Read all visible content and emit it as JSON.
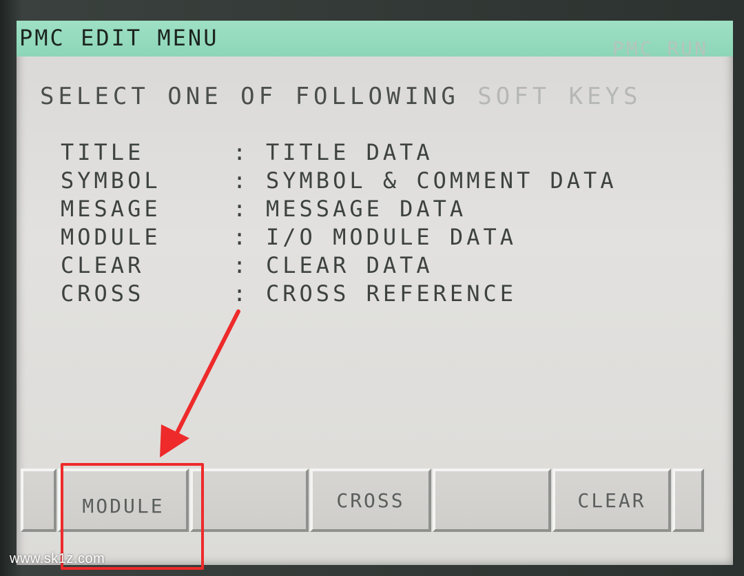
{
  "header": {
    "title": "PMC EDIT MENU",
    "status": "PMC RUN"
  },
  "prompt": {
    "main": "SELECT ONE OF FOLLOWING ",
    "faded": "SOFT KEYS"
  },
  "menu": {
    "items": [
      {
        "key": "TITLE",
        "sep": ":",
        "desc": "TITLE DATA"
      },
      {
        "key": "SYMBOL",
        "sep": ":",
        "desc": "SYMBOL & COMMENT DATA"
      },
      {
        "key": "MESAGE",
        "sep": ":",
        "desc": "MESSAGE DATA"
      },
      {
        "key": "MODULE",
        "sep": ":",
        "desc": "I/O MODULE DATA"
      },
      {
        "key": "CLEAR",
        "sep": ":",
        "desc": "CLEAR DATA"
      },
      {
        "key": "CROSS",
        "sep": ":",
        "desc": "CROSS REFERENCE"
      }
    ]
  },
  "softkeys": {
    "items": [
      {
        "label": "MODULE"
      },
      {
        "label": ""
      },
      {
        "label": "CROSS"
      },
      {
        "label": ""
      },
      {
        "label": "CLEAR"
      }
    ]
  },
  "annotation": {
    "color": "#ee2a2a"
  },
  "watermark": "www.sk1z.com"
}
